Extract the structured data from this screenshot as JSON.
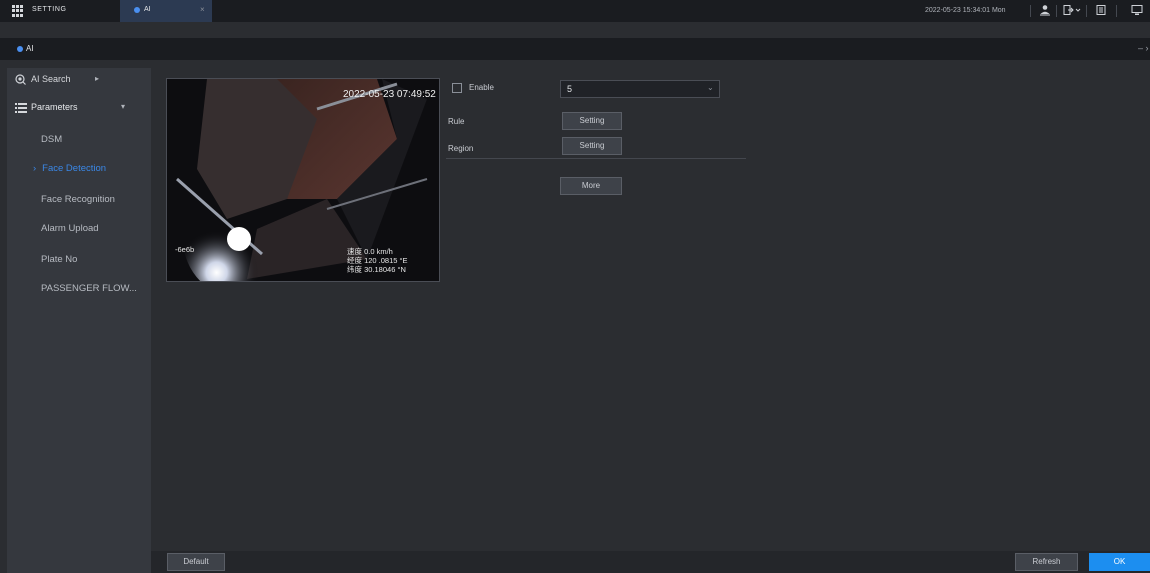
{
  "topbar": {
    "setting_tab": "SETTING",
    "ai_tab": "AI",
    "close_glyph": "×",
    "datetime": "2022-05-23 15:34:01 Mon"
  },
  "subbar": {
    "title": "AI",
    "minimize": "– ›"
  },
  "sidebar": {
    "ai_search": "AI Search",
    "parameters": "Parameters",
    "items": [
      "DSM",
      "Face Detection",
      "Face Recognition",
      "Alarm Upload",
      "Plate No",
      "PASSENGER FLOW..."
    ],
    "active_index": 1
  },
  "preview": {
    "timestamp": "2022-05-23 07:49:52",
    "overlay_left": "-6e6b",
    "overlay_lines": [
      "速度 0.0 km/h",
      "经度 120 .0815 °E",
      "纬度 30.18046 °N"
    ]
  },
  "form": {
    "enable_label": "Enable",
    "enabled": false,
    "channel_value": "5",
    "rule_label": "Rule",
    "rule_button": "Setting",
    "region_label": "Region",
    "region_button": "Setting",
    "more_button": "More"
  },
  "footer": {
    "default_button": "Default",
    "refresh_button": "Refresh",
    "ok_button": "OK"
  },
  "colors": {
    "accent": "#1c8ef0",
    "active_text": "#3a87e6",
    "background": "#2b2d31",
    "sidebar": "#35383e"
  }
}
